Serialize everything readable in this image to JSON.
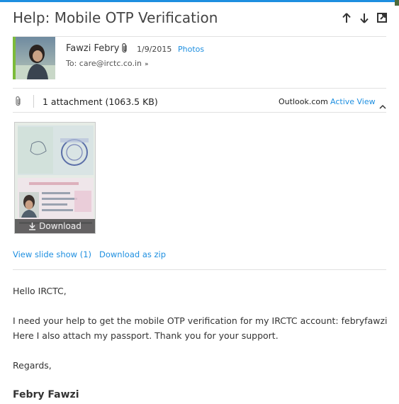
{
  "header": {
    "subject": "Help: Mobile OTP Verification",
    "accent_color": "#1e8fe0",
    "icons": [
      "arrow-up-icon",
      "arrow-down-icon",
      "popout-icon"
    ]
  },
  "sender": {
    "name": "Fawzi Febry",
    "date": "1/9/2015",
    "photos_link": "Photos",
    "to_line": "To: care@irctc.co.in",
    "status_color": "#7cbb3a"
  },
  "attachments": {
    "count_label": "1 attachment (1063.5 KB)",
    "provider_label": "Outlook.com",
    "active_view_link": "Active View",
    "thumbnail_button": "Download",
    "slide_show_link": "View slide show (1)",
    "zip_link": "Download as zip"
  },
  "message": {
    "greeting": "Hello IRCTC,",
    "line1": "I need your help to get the mobile OTP verification for my IRCTC account: febryfawzi",
    "line2": "Here I also attach my passport. Thank you for your support.",
    "closing": "Regards,",
    "signature": "Febry Fawzi"
  }
}
